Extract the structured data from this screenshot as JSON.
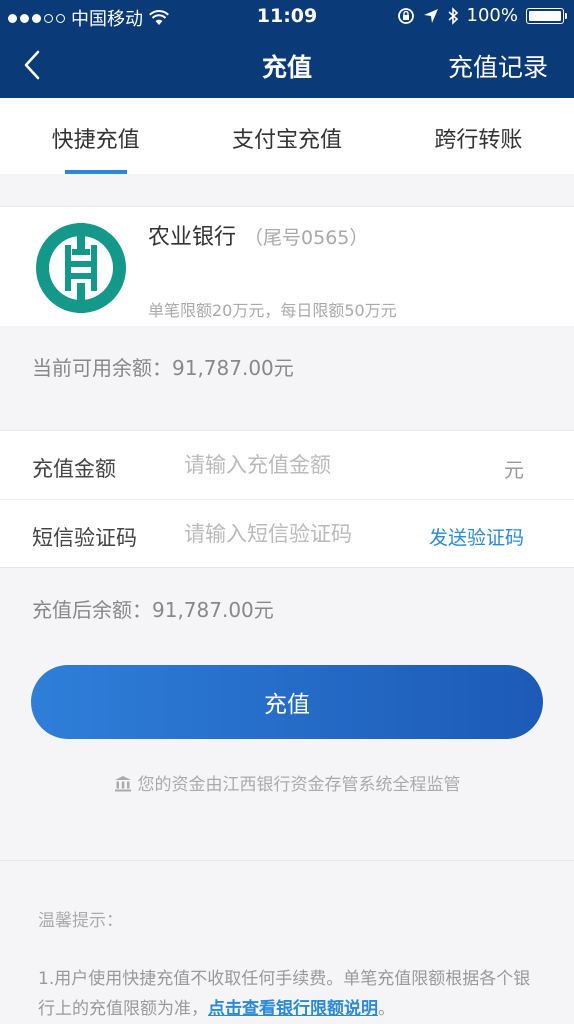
{
  "status_bar": {
    "carrier": "中国移动",
    "time": "11:09",
    "battery": "100%"
  },
  "nav": {
    "title": "充值",
    "records": "充值记录"
  },
  "tabs": [
    {
      "label": "快捷充值",
      "active": true
    },
    {
      "label": "支付宝充值",
      "active": false
    },
    {
      "label": "跨行转账",
      "active": false
    }
  ],
  "bank_card": {
    "name": "农业银行",
    "tail": "（尾号0565）",
    "limit": "单笔限额20万元，每日限额50万元",
    "logo_color": "#13988a"
  },
  "balance": "当前可用余额：91,787.00元",
  "form": {
    "amount_label": "充值金额",
    "amount_placeholder": "请输入充值金额",
    "amount_unit": "元",
    "sms_label": "短信验证码",
    "sms_placeholder": "请输入短信验证码",
    "send_code": "发送验证码"
  },
  "after_balance": "充值后余额：91,787.00元",
  "submit": "充值",
  "supervise": "您的资金由江西银行资金存管系统全程监管",
  "tips": {
    "title": "温馨提示：",
    "tip1_text": "1.用户使用快捷充值不收取任何手续费。单笔充值限额根据各个银行上的充值限额为准，",
    "tip1_link": "点击查看银行限额说明",
    "tip1_end": "。"
  },
  "colors": {
    "header": "#0a3a78",
    "accent": "#2b8ad8"
  }
}
